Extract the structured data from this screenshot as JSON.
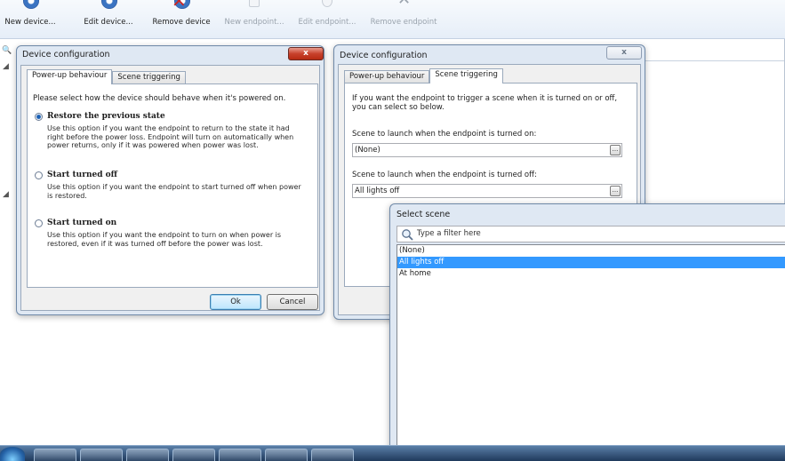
{
  "toolbar": {
    "new_device": "New device...",
    "edit_device": "Edit device...",
    "remove_device": "Remove device",
    "new_endpoint": "New endpoint...",
    "edit_endpoint": "Edit endpoint...",
    "remove_endpoint": "Remove endpoint"
  },
  "dialog1": {
    "title": "Device configuration",
    "close": "x",
    "tabs": [
      "Power-up behaviour",
      "Scene triggering"
    ],
    "prompt": "Please select how the device should behave when it's powered on.",
    "options": [
      {
        "label": "Restore the previous state",
        "desc": "Use this option if you want the endpoint to return to the state it had right before the power loss. Endpoint will turn on automatically when power returns, only if it was powered when power was lost.",
        "selected": true
      },
      {
        "label": "Start turned off",
        "desc": "Use this option if you want the endpoint to start turned off when power is restored.",
        "selected": false
      },
      {
        "label": "Start turned on",
        "desc": "Use this option if you want the endpoint to turn on when power is restored, even if it was turned off before the power was lost.",
        "selected": false
      }
    ],
    "ok": "Ok",
    "cancel": "Cancel"
  },
  "dialog2": {
    "title": "Device configuration",
    "close": "x",
    "tabs": [
      "Power-up behaviour",
      "Scene triggering"
    ],
    "intro": "If you want the endpoint to trigger a scene when it is turned on or off, you can select so below.",
    "on_label": "Scene to launch when the endpoint is turned on:",
    "on_value": "(None)",
    "off_label": "Scene to launch when the endpoint is turned off:",
    "off_value": "All lights off",
    "browse": "..."
  },
  "select_scene": {
    "title": "Select scene",
    "filter_placeholder": "Type a filter here",
    "items": [
      "(None)",
      "All lights off",
      "At home"
    ],
    "selected_index": 1
  },
  "colors": {
    "selection": "#3399ff",
    "window_frame": "#dfe8f3"
  }
}
